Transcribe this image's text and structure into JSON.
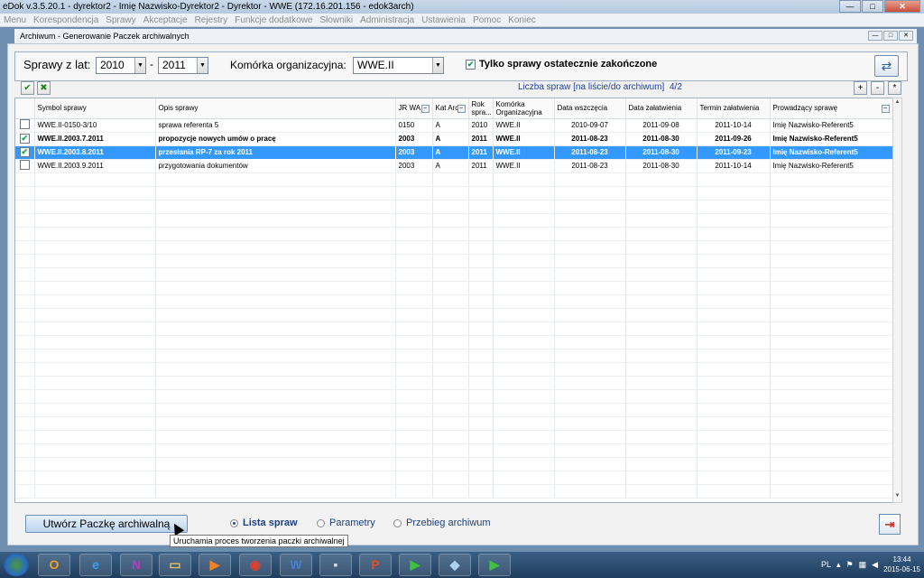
{
  "window": {
    "title": "eDok v.3.5.20.1 - dyrektor2 - Imię Nazwisko-Dyrektor2 - Dyrektor - WWE   (172.16.201.156 - edok3arch)",
    "buttons": {
      "minimize": "—",
      "maximize": "□",
      "close": "✕"
    }
  },
  "menu": [
    "Menu",
    "Korespondencja",
    "Sprawy",
    "Akceptacje",
    "Rejestry",
    "Funkcje dodatkowe",
    "Słowniki",
    "Administracja",
    "Ustawienia",
    "Pomoc",
    "Koniec"
  ],
  "child_window": {
    "title": "Archiwum - Generowanie Paczek archiwalnych"
  },
  "filters": {
    "years_label": "Sprawy z lat:",
    "year_from": "2010",
    "dash": "-",
    "year_to": "2011",
    "unit_label": "Komórka organizacyjna:",
    "unit_value": "WWE.II",
    "only_final_label": "Tylko sprawy ostatecznie zakończone",
    "only_final_checked": true
  },
  "toolbar": {
    "count_label": "Liczba spraw [na liście/do archiwum]",
    "count_value": "4/2",
    "plus": "+",
    "minus": "-",
    "star": "*"
  },
  "grid": {
    "columns": [
      "",
      "Symbol sprawy",
      "Opis sprawy",
      "JR WA",
      "Kat Arch",
      "Rok spra...",
      "Komórka Organizacyjna",
      "Data wszczęcia",
      "Data załatwienia",
      "Termin załatwienia",
      "Prowadzący sprawę"
    ],
    "rows": [
      {
        "checked": false,
        "bold": false,
        "selected": false,
        "symbol": "WWE.II-0150-3/10",
        "opis": "sprawa referenta 5",
        "jrwa": "0150",
        "kat": "A",
        "rok": "2010",
        "komorka": "WWE.II",
        "wszczecia": "2010-09-07",
        "zalatwienia": "2011-09-08",
        "termin": "2011-10-14",
        "prowadzacy": "Imię Nazwisko-Referent5"
      },
      {
        "checked": true,
        "bold": true,
        "selected": false,
        "symbol": "WWE.II.2003.7.2011",
        "opis": "propozycje nowych umów o pracę",
        "jrwa": "2003",
        "kat": "A",
        "rok": "2011",
        "komorka": "WWE.II",
        "wszczecia": "2011-08-23",
        "zalatwienia": "2011-08-30",
        "termin": "2011-09-26",
        "prowadzacy": "Imię Nazwisko-Referent5"
      },
      {
        "checked": true,
        "bold": true,
        "selected": true,
        "symbol": "WWE.II.2003.8.2011",
        "opis": "przesłania RP-7 za rok 2011",
        "jrwa": "2003",
        "kat": "A",
        "rok": "2011",
        "komorka": "WWE.II",
        "wszczecia": "2011-08-23",
        "zalatwienia": "2011-08-30",
        "termin": "2011-09-23",
        "prowadzacy": "Imię Nazwisko-Referent5"
      },
      {
        "checked": false,
        "bold": false,
        "selected": false,
        "symbol": "WWE.II.2003.9.2011",
        "opis": "przygotowania dokumentów",
        "jrwa": "2003",
        "kat": "A",
        "rok": "2011",
        "komorka": "WWE.II",
        "wszczecia": "2011-08-23",
        "zalatwienia": "2011-08-30",
        "termin": "2011-10-14",
        "prowadzacy": "Imię Nazwisko-Referent5"
      }
    ]
  },
  "bottom": {
    "create_button": "Utwórz Paczkę archiwalną",
    "tooltip": "Uruchamia proces tworzenia paczki archiwalnej",
    "radios": [
      {
        "label": "Lista spraw",
        "selected": true
      },
      {
        "label": "Parametry",
        "selected": false
      },
      {
        "label": "Przebieg archiwum",
        "selected": false
      }
    ]
  },
  "taskbar": {
    "apps": [
      "outlook-icon",
      "ie-icon",
      "onenote-icon",
      "explorer-icon",
      "media-player-icon",
      "chrome-icon",
      "word-icon",
      "cmd-icon",
      "powerpoint-icon",
      "edok-icon",
      "notes-icon",
      "edok-icon"
    ],
    "lang": "PL",
    "time": "13:44",
    "date": "2015-06-15"
  }
}
